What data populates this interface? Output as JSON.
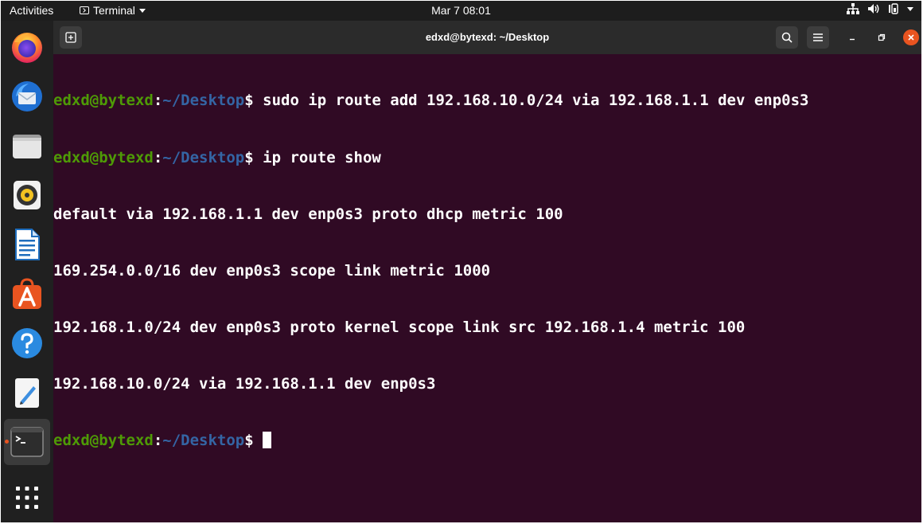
{
  "topbar": {
    "activities": "Activities",
    "app_name": "Terminal",
    "clock": "Mar 7  08:01"
  },
  "dock": {
    "items": [
      {
        "name": "firefox-icon"
      },
      {
        "name": "thunderbird-icon"
      },
      {
        "name": "files-icon"
      },
      {
        "name": "rhythmbox-icon"
      },
      {
        "name": "libreoffice-writer-icon"
      },
      {
        "name": "ubuntu-software-icon"
      },
      {
        "name": "help-icon"
      },
      {
        "name": "text-editor-icon"
      },
      {
        "name": "terminal-icon"
      },
      {
        "name": "show-applications-icon"
      }
    ]
  },
  "window": {
    "title": "edxd@bytexd: ~/Desktop"
  },
  "terminal": {
    "user_host": "edxd@bytexd",
    "path": "~/Desktop",
    "prompt_suffix": "$ ",
    "colon": ":",
    "cmd1": "sudo ip route add 192.168.10.0/24 via 192.168.1.1 dev enp0s3",
    "cmd2": "ip route show",
    "out1": "default via 192.168.1.1 dev enp0s3 proto dhcp metric 100",
    "out2": "169.254.0.0/16 dev enp0s3 scope link metric 1000",
    "out3": "192.168.1.0/24 dev enp0s3 proto kernel scope link src 192.168.1.4 metric 100",
    "out4": "192.168.10.0/24 via 192.168.1.1 dev enp0s3"
  },
  "colors": {
    "terminal_bg": "#300a24",
    "prompt_user": "#4e9a06",
    "prompt_path": "#3465a4",
    "close_button": "#e95420"
  }
}
